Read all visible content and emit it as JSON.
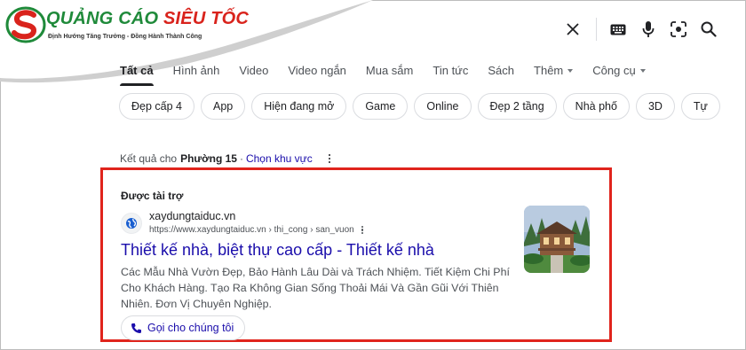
{
  "logo": {
    "name_green": "QUẢNG CÁO ",
    "name_red": "SIÊU TỐC",
    "slogan": "Định Hướng Tăng Trưởng - Đồng Hành Thành Công",
    "colors": {
      "green": "#1f8a3a",
      "red": "#d9231c"
    }
  },
  "search_icons": [
    "close-icon",
    "keyboard-icon",
    "mic-icon",
    "lens-icon",
    "search-icon"
  ],
  "tabs": [
    {
      "label": "Tất cả",
      "active": true
    },
    {
      "label": "Hình ảnh"
    },
    {
      "label": "Video"
    },
    {
      "label": "Video ngắn"
    },
    {
      "label": "Mua sắm"
    },
    {
      "label": "Tin tức"
    },
    {
      "label": "Sách"
    },
    {
      "label": "Thêm",
      "dropdown": true
    },
    {
      "label": "Công cụ",
      "dropdown": true
    }
  ],
  "chips": [
    "Đẹp cấp 4",
    "App",
    "Hiện đang mở",
    "Game",
    "Online",
    "Đẹp 2 tầng",
    "Nhà phố",
    "3D",
    "Tự"
  ],
  "results_for": {
    "prefix": "Kết quả cho",
    "location": "Phường 15",
    "separator": "·",
    "change_link": "Chọn khu vực"
  },
  "ad": {
    "sponsored_label": "Được tài trợ",
    "site_name": "xaydungtaiduc.vn",
    "site_url": "https://www.xaydungtaiduc.vn › thi_cong › san_vuon",
    "title": "Thiết kế nhà, biệt thự cao cấp - Thiết kế nhà",
    "description": "Các Mẫu Nhà Vườn Đẹp, Bảo Hành Lâu Dài và Trách Nhiệm. Tiết Kiệm Chi Phí Cho Khách Hàng. Tạo Ra Không Gian Sống Thoải Mái Và Gần Gũi Với Thiên Nhiên. Đơn Vị Chuyên Nghiệp.",
    "call_button": "Gọi cho chúng tôi",
    "highlight_color": "#e0241c"
  }
}
